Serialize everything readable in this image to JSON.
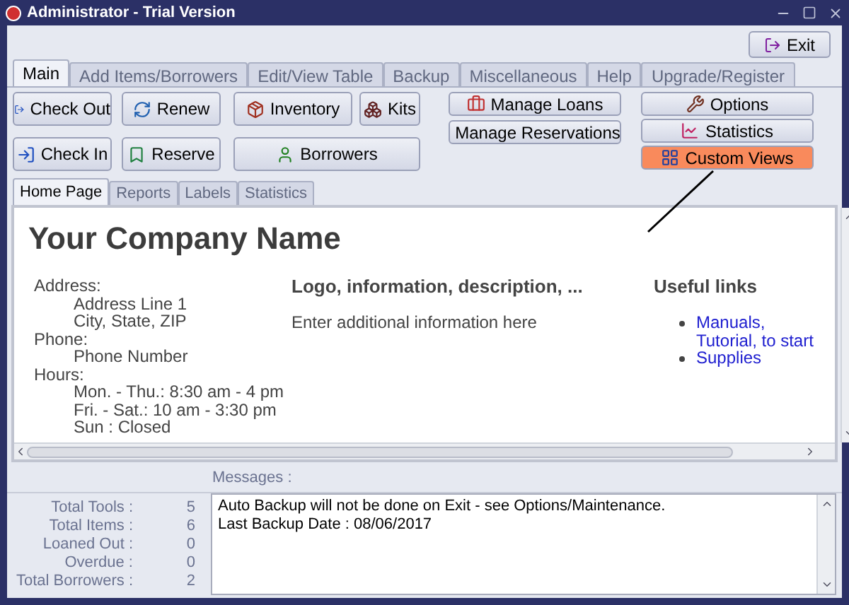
{
  "window": {
    "title": "Administrator - Trial Version"
  },
  "exit_button": {
    "label": "Exit"
  },
  "tabs": [
    {
      "label": "Main",
      "selected": true
    },
    {
      "label": "Add Items/Borrowers",
      "selected": false
    },
    {
      "label": "Edit/View Table",
      "selected": false
    },
    {
      "label": "Backup",
      "selected": false
    },
    {
      "label": "Miscellaneous",
      "selected": false
    },
    {
      "label": "Help",
      "selected": false
    },
    {
      "label": "Upgrade/Register",
      "selected": false
    }
  ],
  "toolbar": {
    "circulation_buttons": [
      {
        "label": "Check Out",
        "kind": "out"
      },
      {
        "label": "Renew",
        "kind": "renew"
      },
      {
        "label": "Check In",
        "kind": "in"
      },
      {
        "label": "Reserve",
        "kind": "reserve"
      }
    ],
    "inventory_buttons": [
      {
        "label": "Inventory",
        "kind": "inventory"
      },
      {
        "label": "Kits",
        "kind": "kits"
      },
      {
        "label": "Borrowers",
        "kind": "borrowers"
      }
    ],
    "manage_buttons": [
      {
        "label": "Manage Loans",
        "kind": "loans"
      },
      {
        "label": "Manage Reservations",
        "kind": "reservations"
      }
    ],
    "view_buttons": [
      {
        "label": "Options",
        "kind": "options",
        "highlighted": false
      },
      {
        "label": "Statistics",
        "kind": "statistics",
        "highlighted": false
      },
      {
        "label": "Custom Views",
        "kind": "views",
        "highlighted": true
      }
    ]
  },
  "sub_tabs": [
    {
      "label": "Home Page",
      "selected": true
    },
    {
      "label": "Reports",
      "selected": false
    },
    {
      "label": "Labels",
      "selected": false
    },
    {
      "label": "Statistics",
      "selected": false
    }
  ],
  "home_page": {
    "company_name": "Your Company Name",
    "contact": [
      {
        "kind": "label",
        "text": "Address:"
      },
      {
        "kind": "value",
        "text": "Address Line 1"
      },
      {
        "kind": "value",
        "text": "City, State, ZIP"
      },
      {
        "kind": "label",
        "text": "Phone:"
      },
      {
        "kind": "value",
        "text": "Phone Number"
      },
      {
        "kind": "label",
        "text": "Hours:"
      },
      {
        "kind": "value",
        "text": "Mon. - Thu.: 8:30 am - 4 pm"
      },
      {
        "kind": "value",
        "text": "Fri. - Sat.: 10 am - 3:30 pm"
      },
      {
        "kind": "value",
        "text": "Sun : Closed"
      }
    ],
    "info_heading": "Logo, information, description, ...",
    "info_text": "Enter additional information here",
    "links_heading": "Useful links",
    "links": [
      "Manuals, Tutorial, to start",
      "Supplies"
    ]
  },
  "messages_label": "Messages :",
  "stats": [
    {
      "label": "Total Tools :",
      "value": "5"
    },
    {
      "label": "Total Items :",
      "value": "6"
    },
    {
      "label": "Loaned Out :",
      "value": "0"
    },
    {
      "label": "Overdue :",
      "value": "0"
    },
    {
      "label": "Total Borrowers :",
      "value": "2"
    }
  ],
  "messages": [
    "Auto Backup will not be done on Exit - see Options/Maintenance.",
    "Last Backup Date : 08/06/2017"
  ]
}
